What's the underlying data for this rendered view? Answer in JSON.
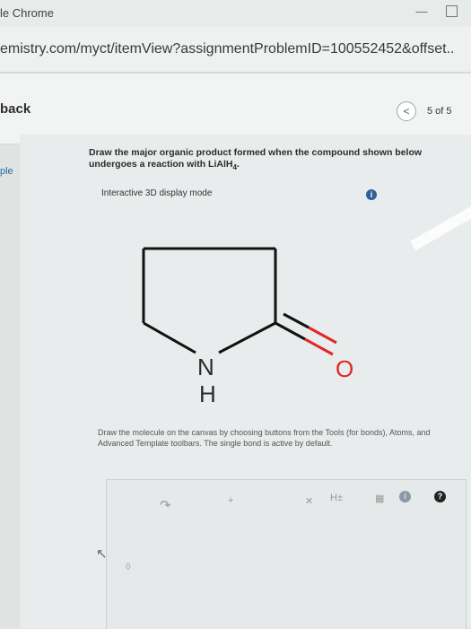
{
  "window": {
    "title": "le Chrome",
    "minimize_glyph": "—",
    "maximize_glyph": ""
  },
  "address_bar": {
    "url": "emistry.com/myct/itemView?assignmentProblemID=100552452&offset.."
  },
  "nav": {
    "back_label": "back",
    "prev_glyph": "<",
    "page_counter": "5 of 5"
  },
  "sidebar": {
    "tab_label": "ple"
  },
  "question": {
    "prompt_line1": "Draw the major organic product formed when the compound shown below",
    "prompt_line2_prefix": "undergoes a reaction with LiAlH",
    "prompt_subscript": "4",
    "prompt_suffix": ".",
    "mode_label": "Interactive 3D display mode",
    "info_glyph": "i"
  },
  "molecule": {
    "name_atom_n": "N",
    "name_atom_h": "H",
    "name_atom_o": "O",
    "bond_color": "#111111",
    "n_color": "#2a2a2a",
    "o_color": "#e02828"
  },
  "instructions": {
    "text": "Draw the molecule on the canvas by choosing buttons from the Tools (for bonds), Atoms, and Advanced Template toolbars. The single bond is active by default."
  },
  "editor": {
    "undo_glyph": "↷",
    "plus_glyph": "+",
    "x_glyph": "✕",
    "h_label": "H±",
    "grid_glyph": "▦",
    "info_glyph": "i",
    "help_glyph": "?",
    "select_glyph": "↖",
    "erase_glyph": "◊"
  }
}
